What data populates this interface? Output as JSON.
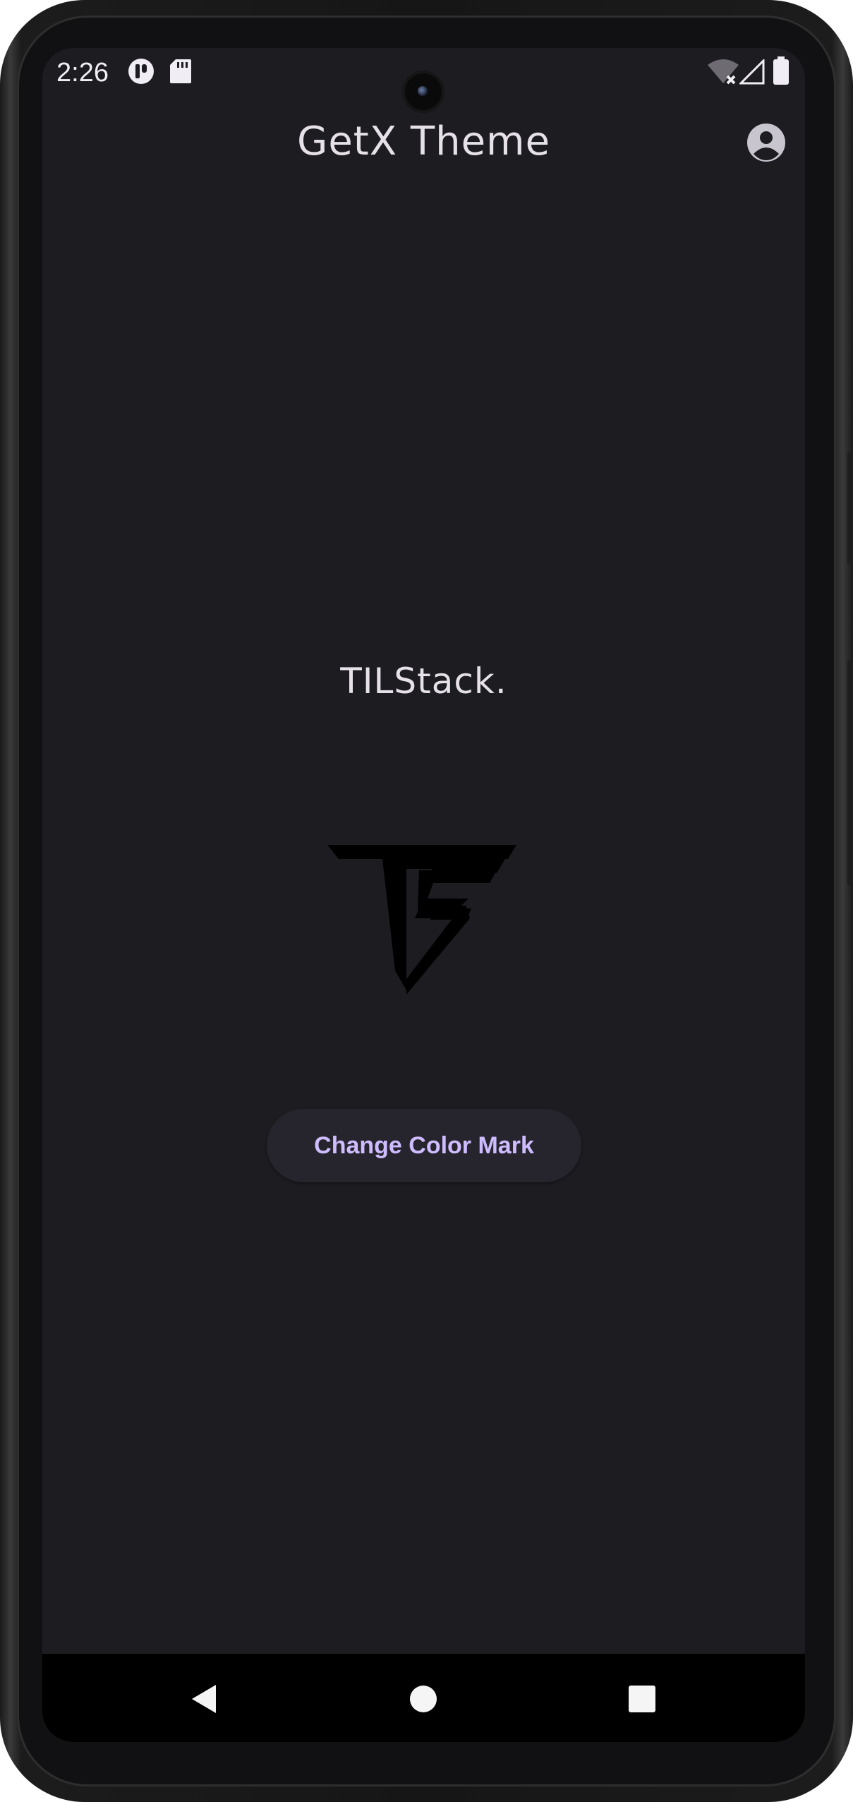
{
  "status_bar": {
    "time": "2:26",
    "left_icons": [
      "app-notification-icon",
      "sd-card-icon"
    ],
    "right_icons": [
      "wifi-off-icon",
      "cellular-signal-icon",
      "battery-icon"
    ]
  },
  "app_bar": {
    "title": "GetX Theme",
    "action_icon": "account-circle-icon"
  },
  "main": {
    "brand_text": "TILStack.",
    "logo_icon": "ts-logo-mark",
    "button_label": "Change Color Mark"
  },
  "nav_bar": {
    "items": [
      "back-icon",
      "home-icon",
      "recents-icon"
    ]
  },
  "colors": {
    "background": "#1d1c21",
    "title_text": "#e6e1e9",
    "button_bg": "#26242c",
    "button_text": "#cfbcff",
    "logo": "#000000"
  }
}
